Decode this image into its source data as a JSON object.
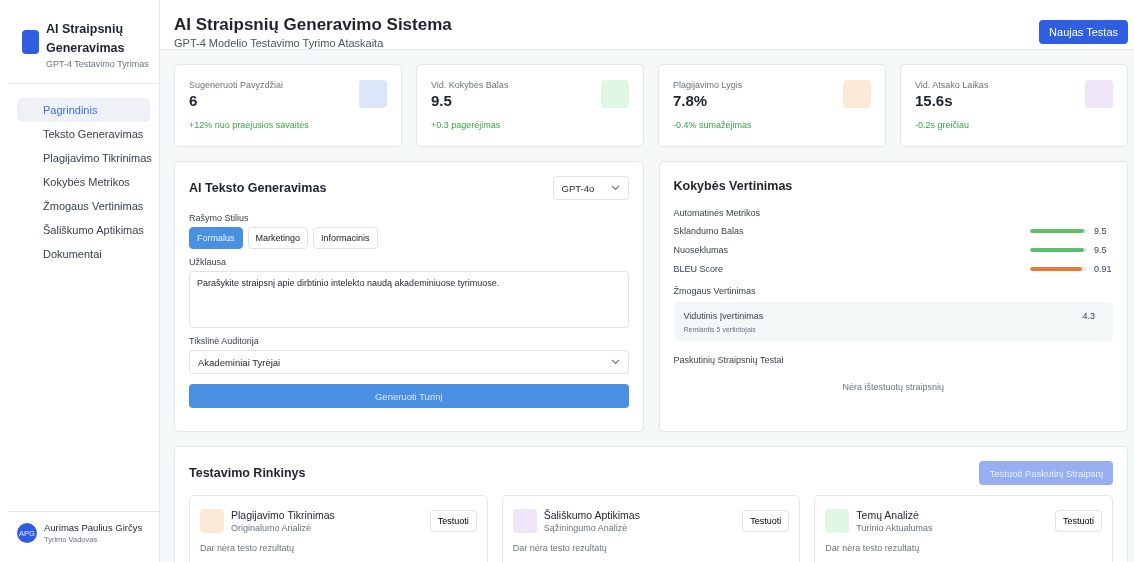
{
  "sidebar": {
    "logo": {
      "title": "AI Straipsnių Generavimas",
      "subtitle": "GPT-4 Testavimo Tyrimas"
    },
    "items": [
      {
        "label": "Pagrindinis",
        "selected": true
      },
      {
        "label": "Teksto Generavimas",
        "selected": false
      },
      {
        "label": "Plagijavimo Tikrinimas",
        "selected": false
      },
      {
        "label": "Kokybės Metrikos",
        "selected": false
      },
      {
        "label": "Žmogaus Vertinimas",
        "selected": false
      },
      {
        "label": "Šališkumo Aptikimas",
        "selected": false
      },
      {
        "label": "Dokumentai",
        "selected": false
      }
    ],
    "user": {
      "initials": "APG",
      "name": "Aurimas Paulius Girčys",
      "role": "Tyrimo Vadovas"
    }
  },
  "header": {
    "title": "AI Straipsnių Generavimo Sistema",
    "subtitle": "GPT-4 Modelio Testavimo Tyrimo Ataskaita",
    "button": "Naujas Testas"
  },
  "stats": [
    {
      "label": "Sugeneruoti Pavyzdžiai",
      "value": "6",
      "change": "+12% nuo praėjusios savaitės",
      "color": "#dce6f9"
    },
    {
      "label": "Vid. Kokybės Balas",
      "value": "9.5",
      "change": "+0.3 pagerėjimas",
      "color": "#dff7e4"
    },
    {
      "label": "Plagijavimo Lygis",
      "value": "7.8%",
      "change": "-0.4% sumažėjimas",
      "color": "#fbebd6"
    },
    {
      "label": "Vid. Atsako Laikas",
      "value": "15.6s",
      "change": "-0.2s greičiau",
      "color": "#eee6f8"
    }
  ],
  "generation": {
    "title": "AI Teksto Generavimas",
    "model": "GPT-4o",
    "style_label": "Rašymo Stilius",
    "styles": [
      {
        "label": "Formalus",
        "selected": true
      },
      {
        "label": "Marketingo",
        "selected": false
      },
      {
        "label": "Informacinis",
        "selected": false
      }
    ],
    "prompt_label": "Užklausa",
    "prompt": "Parašykite straipsnį apie dirbtinio intelekto naudą akademiniuose tyrimuose.",
    "audience_label": "Tikslinė Auditorija",
    "audience": "Akademiniai Tyrėjai",
    "button": "Generuoti Turinį"
  },
  "quality": {
    "title": "Kokybės Vertinimas",
    "auto_label": "Automatinės Metrikos",
    "metrics": [
      {
        "name": "Sklandumo Balas",
        "level": 0.95,
        "reading": "9.5",
        "color": "#5cbf6a"
      },
      {
        "name": "Nuoseklumas",
        "level": 0.95,
        "reading": "9.5",
        "color": "#5cbf6a"
      },
      {
        "name": "BLEU Score",
        "level": 0.91,
        "reading": "0.91",
        "color": "#e67a35"
      }
    ],
    "human_label": "Žmogaus Vertinimas",
    "human": {
      "label": "Vidutinis Įvertinimas",
      "value": "4.3",
      "note": "Remiantis 5 vertintojais"
    },
    "recent_label": "Paskutinių Straipsnių Testai",
    "recent_empty": "Nėra ištestuotų straipsnių"
  },
  "suite": {
    "title": "Testavimo Rinkinys",
    "button": "Testuoti Paskutinį Straipsnį",
    "button_disabled": true,
    "tests": [
      {
        "title": "Plagijavimo Tikrinimas",
        "subtitle": "Originalumo Analizė",
        "button": "Testuoti",
        "result": "Dar nėra testo rezultatų",
        "color": "#fbebd6"
      },
      {
        "title": "Šališkumo Aptikimas",
        "subtitle": "Sąžiningumo Analizė",
        "button": "Testuoti",
        "result": "Dar nėra testo rezultatų",
        "color": "#eee6f8"
      },
      {
        "title": "Temų Analizė",
        "subtitle": "Turinio Aktualumas",
        "button": "Testuoti",
        "result": "Dar nėra testo rezultatų",
        "color": "#dff7e4"
      }
    ]
  }
}
